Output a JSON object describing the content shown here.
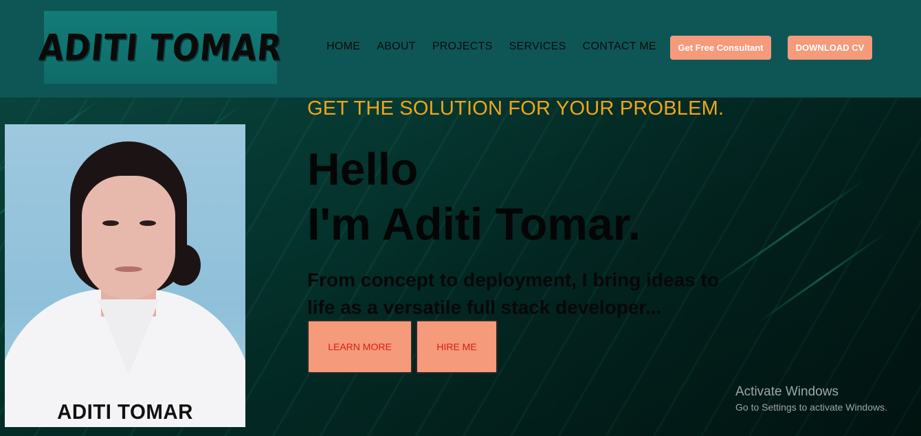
{
  "header": {
    "logo_text": "ADITI TOMAR",
    "nav": [
      "HOME",
      "ABOUT",
      "PROJECTS",
      "SERVICES",
      "CONTACT ME"
    ],
    "consult_button": "Get Free Consultant",
    "cv_button": "DOWNLOAD CV",
    "colors": {
      "header_bg": "#0e5656",
      "button_bg": "#f59a7a"
    }
  },
  "profile": {
    "photo_caption": "ADITI TOMAR"
  },
  "hero": {
    "tagline": "GET THE SOLUTION FOR YOUR PROBLEM.",
    "hello": "Hello",
    "name": "I'm Aditi Tomar.",
    "description": "From concept to deployment, I bring ideas to life as a versatile full stack developer...",
    "learn_more": "LEARN MORE",
    "hire_me": "HIRE ME",
    "colors": {
      "tagline": "#f0a617",
      "cta_text": "#d61e14"
    }
  },
  "watermark": {
    "title": "Activate Windows",
    "subtitle": "Go to Settings to activate Windows."
  }
}
